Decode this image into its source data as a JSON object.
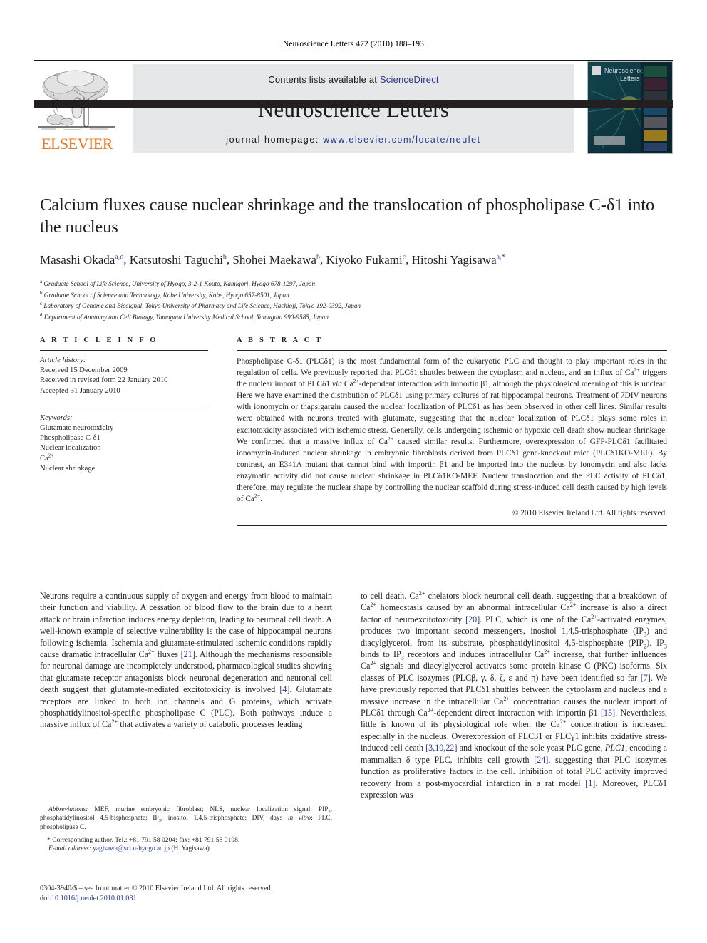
{
  "running_head": "Neuroscience Letters 472 (2010) 188–193",
  "masthead": {
    "contents_prefix": "Contents lists available at ",
    "sciencedirect": "ScienceDirect",
    "journal_name": "Neuroscience Letters",
    "homepage_prefix": "journal homepage: ",
    "homepage_url": "www.elsevier.com/locate/neulet",
    "publisher_wordmark": "ELSEVIER",
    "publisher_logo_icon": "elsevier-tree-icon",
    "cover_icon": "journal-cover-thumbnail",
    "cover_title_line1": "Neuroscience",
    "cover_title_line2": "Letters",
    "accent_orange": "#E87722",
    "link_blue": "#2b3a8f",
    "band_gray": "#e6e7e8",
    "rule_black": "#231f20"
  },
  "article": {
    "title": "Calcium fluxes cause nuclear shrinkage and the translocation of phospholipase C-δ1 into the nucleus",
    "authors": [
      {
        "name": "Masashi Okada",
        "marks": "a,d",
        "sep": ", "
      },
      {
        "name": "Katsutoshi Taguchi",
        "marks": "b",
        "sep": ", "
      },
      {
        "name": "Shohei Maekawa",
        "marks": "b",
        "sep": ", "
      },
      {
        "name": "Kiyoko Fukami",
        "marks": "c",
        "sep": ", "
      },
      {
        "name": "Hitoshi Yagisawa",
        "marks": "a,*",
        "sep": ""
      }
    ],
    "affiliations": [
      {
        "mark": "a",
        "text": "Graduate School of Life Science, University of Hyogo, 3-2-1 Kouto, Kamigori, Hyogo 678-1297, Japan"
      },
      {
        "mark": "b",
        "text": "Graduate School of Science and Technology, Kobe University, Kobe, Hyogo 657-8501, Japan"
      },
      {
        "mark": "c",
        "text": "Laboratory of Genome and Biosignal, Tokyo University of Pharmacy and Life Science, Hachioji, Tokyo 192-0392, Japan"
      },
      {
        "mark": "d",
        "text": "Department of Anatomy and Cell Biology, Yamagata University Medical School, Yamagata 990-9585, Japan"
      }
    ]
  },
  "article_info": {
    "heading": "A R T I C L E   I N F O",
    "history_label": "Article history:",
    "history": [
      "Received 15 December 2009",
      "Received in revised form 22 January 2010",
      "Accepted 31 January 2010"
    ],
    "keywords_label": "Keywords:",
    "keywords": [
      "Glutamate neurotoxicity",
      "Phospholipase C-δ1",
      "Nuclear localization",
      "Ca2+",
      "Nuclear shrinkage"
    ]
  },
  "abstract": {
    "heading": "A B S T R A C T",
    "body": "Phospholipase C-δ1 (PLCδ1) is the most fundamental form of the eukaryotic PLC and thought to play important roles in the regulation of cells. We previously reported that PLCδ1 shuttles between the cytoplasm and nucleus, and an influx of Ca2+ triggers the nuclear import of PLCδ1 via Ca2+-dependent interaction with importin β1, although the physiological meaning of this is unclear. Here we have examined the distribution of PLCδ1 using primary cultures of rat hippocampal neurons. Treatment of 7DIV neurons with ionomycin or thapsigargin caused the nuclear localization of PLCδ1 as has been observed in other cell lines. Similar results were obtained with neurons treated with glutamate, suggesting that the nuclear localization of PLCδ1 plays some roles in excitotoxicity associated with ischemic stress. Generally, cells undergoing ischemic or hypoxic cell death show nuclear shrinkage. We confirmed that a massive influx of Ca2+ caused similar results. Furthermore, overexpression of GFP-PLCδ1 facilitated ionomycin-induced nuclear shrinkage in embryonic fibroblasts derived from PLCδ1 gene-knockout mice (PLCδ1KO-MEF). By contrast, an E341A mutant that cannot bind with importin β1 and be imported into the nucleus by ionomycin and also lacks enzymatic activity did not cause nuclear shrinkage in PLCδ1KO-MEF. Nuclear translocation and the PLC activity of PLCδ1, therefore, may regulate the nuclear shape by controlling the nuclear scaffold during stress-induced cell death caused by high levels of Ca2+.",
    "copyright": "© 2010 Elsevier Ireland Ltd. All rights reserved."
  },
  "body": {
    "left_column": "Neurons require a continuous supply of oxygen and energy from blood to maintain their function and viability. A cessation of blood flow to the brain due to a heart attack or brain infarction induces energy depletion, leading to neuronal cell death. A well-known example of selective vulnerability is the case of hippocampal neurons following ischemia. Ischemia and glutamate-stimulated ischemic conditions rapidly cause dramatic intracellular Ca2+ fluxes [21]. Although the mechanisms responsible for neuronal damage are incompletely understood, pharmacological studies showing that glutamate receptor antagonists block neuronal degeneration and neuronal cell death suggest that glutamate-mediated excitotoxicity is involved [4]. Glutamate receptors are linked to both ion channels and G proteins, which activate phosphatidylinositol-specific phospholipase C (PLC). Both pathways induce a massive influx of Ca2+ that activates a variety of catabolic processes leading",
    "right_column": "to cell death. Ca2+ chelators block neuronal cell death, suggesting that a breakdown of Ca2+ homeostasis caused by an abnormal intracellular Ca2+ increase is also a direct factor of neuroexcitotoxicity [20]. PLC, which is one of the Ca2+-activated enzymes, produces two important second messengers, inositol 1,4,5-trisphosphate (IP3) and diacylglycerol, from its substrate, phosphatidylinositol 4,5-bisphosphate (PIP2). IP3 binds to IP3 receptors and induces intracellular Ca2+ increase, that further influences Ca2+ signals and diacylglycerol activates some protein kinase C (PKC) isoforms. Six classes of PLC isozymes (PLCβ, γ, δ, ζ, ε and η) have been identified so far [7]. We have previously reported that PLCδ1 shuttles between the cytoplasm and nucleus and a massive increase in the intracellular Ca2+ concentration causes the nuclear import of PLCδ1 through Ca2+-dependent direct interaction with importin β1 [15]. Nevertheless, little is known of its physiological role when the Ca2+ concentration is increased, especially in the nucleus. Overexpression of PLCβ1 or PLCγ1 inhibits oxidative stress-induced cell death [3,10,22] and knockout of the sole yeast PLC gene, PLC1, encoding a mammalian δ type PLC, inhibits cell growth [24], suggesting that PLC isozymes function as proliferative factors in the cell. Inhibition of total PLC activity improved recovery from a post-myocardial infarction in a rat model [1]. Moreover, PLCδ1 expression was"
  },
  "footnotes": {
    "abbreviations_label": "Abbreviations:",
    "abbreviations_text": " MEF, murine embryonic fibroblast; NLS, nuclear localization signal; PIP2, phosphatidylinositol 4,5-bisphosphate; IP3, inositol 1,4,5-trisphosphate; DIV, days in vitro; PLC, phospholipase C.",
    "corresponding": "* Corresponding author. Tel.: +81 791 58 0204; fax: +81 791 58 0198.",
    "email_label": "E-mail address:",
    "email": "yagisawa@sci.u-hyogo.ac.jp",
    "email_suffix": " (H. Yagisawa)."
  },
  "issn": {
    "line1": "0304-3940/$ – see front matter © 2010 Elsevier Ireland Ltd. All rights reserved.",
    "doi_label": "doi:",
    "doi": "10.1016/j.neulet.2010.01.081"
  }
}
